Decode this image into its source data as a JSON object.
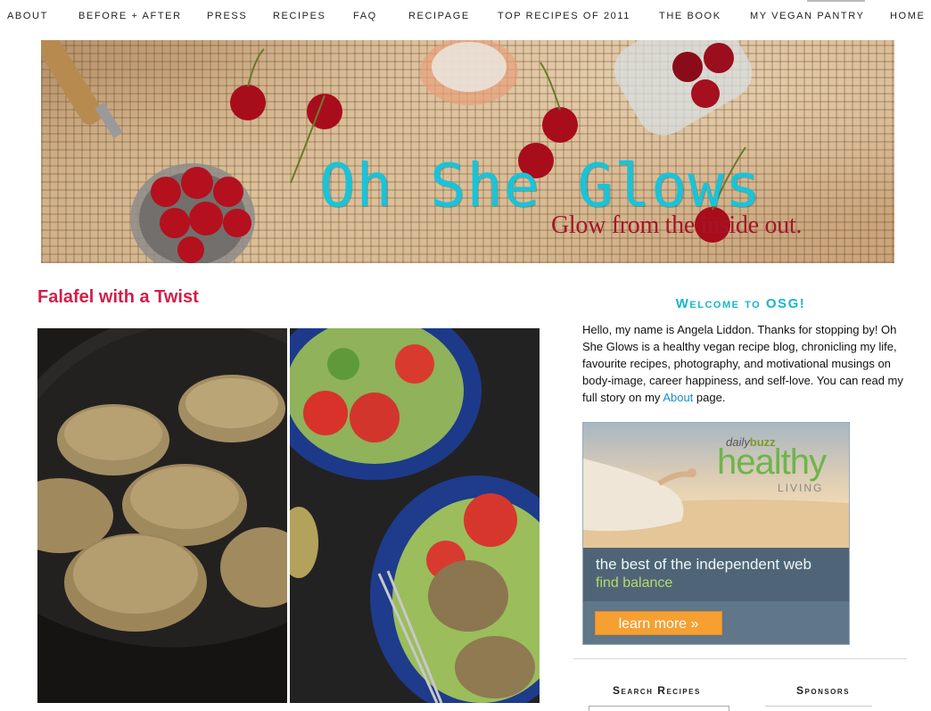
{
  "nav": {
    "items": [
      {
        "label": "About"
      },
      {
        "label": "Before + After"
      },
      {
        "label": "Press"
      },
      {
        "label": "Recipes"
      },
      {
        "label": "FAQ"
      },
      {
        "label": "Recipage"
      },
      {
        "label": "Top Recipes of 2011"
      },
      {
        "label": "The Book"
      },
      {
        "label": "My Vegan Pantry"
      },
      {
        "label": "Home"
      }
    ]
  },
  "header": {
    "title": "Oh She Glows",
    "tagline": "Glow from the inside out."
  },
  "post": {
    "title": "Falafel with a Twist"
  },
  "sidebar": {
    "welcome_heading": "Welcome to OSG!",
    "intro_text": "Hello, my name is Angela Liddon. Thanks for stopping by! Oh She Glows is a healthy vegan recipe blog, chronicling my life, favourite recipes, photography, and motivational musings on body-image, career happiness, and self-love. You can read my full story on my ",
    "about_link": "About",
    "intro_suffix": " page.",
    "ad": {
      "brand_prefix": "daily",
      "brand_suffix": "buzz",
      "brand_big": "healthy",
      "brand_sub": "LIVING",
      "line1": "the best of the independent web",
      "line2": "find balance",
      "cta": "learn more »"
    },
    "search_heading": "Search Recipes",
    "sponsors_heading": "Sponsors"
  },
  "colors": {
    "accent_title": "#d01f4a",
    "welcome": "#18b6c9",
    "banner_title": "#19c3d8",
    "tagline": "#a3162a"
  }
}
